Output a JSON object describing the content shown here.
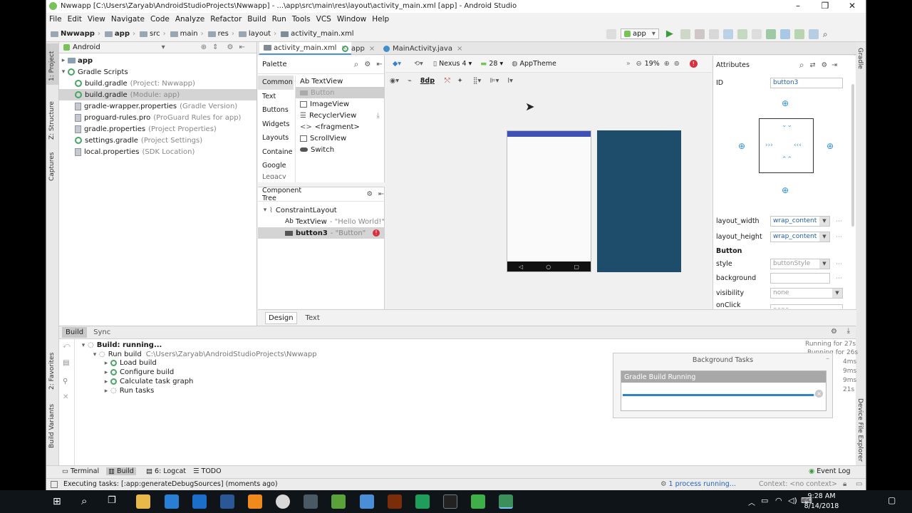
{
  "window": {
    "title": "Nwwapp [C:\\Users\\Zaryab\\AndroidStudioProjects\\Nwwapp] - ...\\app\\src\\main\\res\\layout\\activity_main.xml [app] - Android Studio",
    "minimize": "–",
    "maximize": "❐",
    "close": "✕"
  },
  "menu": [
    "File",
    "Edit",
    "View",
    "Navigate",
    "Code",
    "Analyze",
    "Refactor",
    "Build",
    "Run",
    "Tools",
    "VCS",
    "Window",
    "Help"
  ],
  "breadcrumbs": [
    "Nwwapp",
    "app",
    "src",
    "main",
    "res",
    "layout",
    "activity_main.xml"
  ],
  "toolbar": {
    "run_config": "app"
  },
  "project_panel": {
    "view_mode": "Android",
    "items": [
      {
        "label": "app",
        "note": "",
        "level": 0,
        "icon": "folder-icon",
        "bold": true
      },
      {
        "label": "Gradle Scripts",
        "note": "",
        "level": 0,
        "icon": "gradle-icon"
      },
      {
        "label": "build.gradle",
        "note": "(Project: Nwwapp)",
        "level": 1,
        "icon": "gradle-icon"
      },
      {
        "label": "build.gradle",
        "note": "(Module: app)",
        "level": 1,
        "icon": "gradle-icon",
        "selected": true
      },
      {
        "label": "gradle-wrapper.properties",
        "note": "(Gradle Version)",
        "level": 1,
        "icon": "properties-icon"
      },
      {
        "label": "proguard-rules.pro",
        "note": "(ProGuard Rules for app)",
        "level": 1,
        "icon": "properties-icon"
      },
      {
        "label": "gradle.properties",
        "note": "(Project Properties)",
        "level": 1,
        "icon": "properties-icon"
      },
      {
        "label": "settings.gradle",
        "note": "(Project Settings)",
        "level": 1,
        "icon": "gradle-icon"
      },
      {
        "label": "local.properties",
        "note": "(SDK Location)",
        "level": 1,
        "icon": "properties-icon"
      }
    ]
  },
  "left_stripe": [
    "1: Project",
    "Z: Structure",
    "Captures",
    "2: Favorites",
    "Build Variants"
  ],
  "right_stripe": [
    "Gradle",
    "Device File Explorer"
  ],
  "editor_tabs": [
    {
      "label": "activity_main.xml",
      "active": true
    },
    {
      "label": "app",
      "active": false
    },
    {
      "label": "MainActivity.java",
      "active": false
    }
  ],
  "palette": {
    "title": "Palette",
    "categories": [
      "Common",
      "Text",
      "Buttons",
      "Widgets",
      "Layouts",
      "Containe",
      "Google",
      "Legacy"
    ],
    "items": [
      "Ab TextView",
      "Button",
      "ImageView",
      "RecyclerView",
      "<fragment>",
      "ScrollView",
      "Switch"
    ]
  },
  "design_toolbar": {
    "device": "Nexus 4",
    "api": "28",
    "theme": "AppTheme",
    "zoom": "19%",
    "margin": "8dp"
  },
  "component_tree": {
    "title": "Component Tree",
    "root": "ConstraintLayout",
    "children": [
      {
        "prefix": "Ab",
        "label": "TextView",
        "note": "- \"Hello World!\""
      },
      {
        "prefix": "",
        "label": "button3",
        "note": "- \"Button\"",
        "selected": true,
        "error": true
      }
    ]
  },
  "attributes": {
    "title": "Attributes",
    "id_label": "ID",
    "id_value": "button3",
    "layout_width_label": "layout_width",
    "layout_width_value": "wrap_content",
    "layout_height_label": "layout_height",
    "layout_height_value": "wrap_content",
    "section": "Button",
    "style_label": "style",
    "style_value": "buttonStyle",
    "background_label": "background",
    "background_value": "",
    "visibility_label": "visibility",
    "visibility_value": "none",
    "onclick_label": "onClick",
    "onclick_value": "none"
  },
  "design_tabs": [
    "Design",
    "Text"
  ],
  "build": {
    "tabs": [
      "Build",
      "Sync"
    ],
    "root": "Build: running...",
    "run_build": "Run build",
    "run_build_path": "C:\\Users\\Zaryab\\AndroidStudioProjects\\Nwwapp",
    "steps": [
      "Load build",
      "Configure build",
      "Calculate task graph",
      "Run tasks"
    ],
    "timers": [
      "Running for 27s",
      "Running for 26s",
      "4ms",
      "9ms",
      "9ms",
      "21s"
    ]
  },
  "background_tasks": {
    "title": "Background Tasks",
    "task": "Gradle Build Running",
    "progress": 0.98
  },
  "tool_windows": [
    "Terminal",
    "Build",
    "6: Logcat",
    "TODO",
    "Event Log"
  ],
  "status": {
    "message": "Executing tasks: [:app:generateDebugSources] (moments ago)",
    "process": "1 process running...",
    "context": "Context: <no context>"
  },
  "taskbar": {
    "time": "9:28 AM",
    "date": "8/14/2018"
  },
  "colors": {
    "accent": "#4b8fd8",
    "blueprint": "#1e4d6b",
    "error": "#d9303f",
    "gradle": "#4aa564"
  }
}
